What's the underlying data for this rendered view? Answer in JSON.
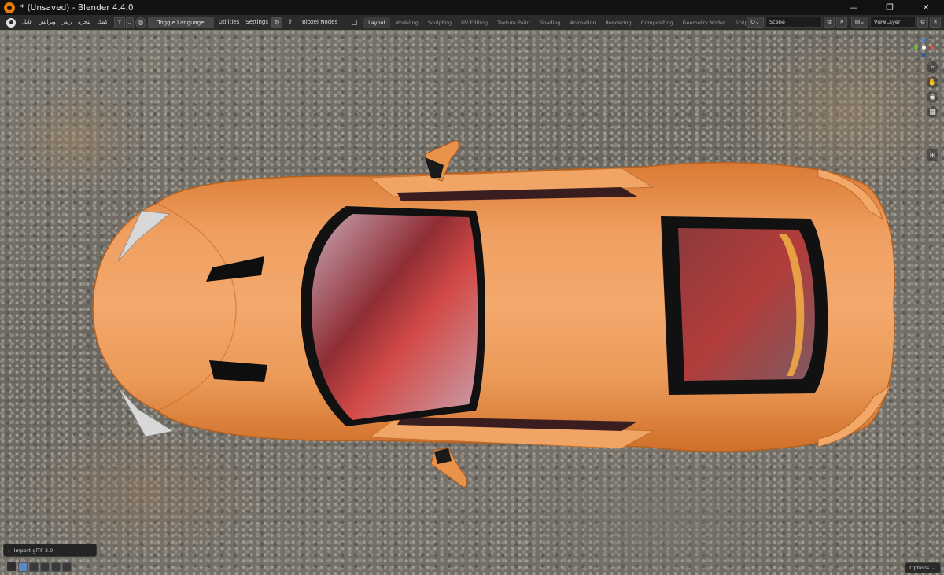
{
  "window": {
    "title": "* (Unsaved) - Blender 4.4.0",
    "minimize_glyph": "—",
    "maximize_glyph": "❐",
    "close_glyph": "✕"
  },
  "menu": {
    "items": [
      "فایل",
      "ویرایش",
      "رندر",
      "پنجره",
      "کمک"
    ],
    "toggle_language": "Toggle Language",
    "utilities": "Utilities",
    "settings": "Settings",
    "bioxel_nodes": "Bioxel Nodes"
  },
  "workspaces": [
    "Layout",
    "Modeling",
    "Sculpting",
    "UV Editing",
    "Texture Paint",
    "Shading",
    "Animation",
    "Rendering",
    "Compositing",
    "Geometry Nodes",
    "Scripting"
  ],
  "active_workspace": "Layout",
  "add_workspace_glyph": "+",
  "scene": {
    "label": "Scene"
  },
  "view_layer": {
    "label": "ViewLayer"
  },
  "viewport": {
    "operator_panel": "Import glTF 2.0",
    "options_label": "Options"
  },
  "icons": {
    "blender_logo": "blender-logo-icon",
    "gizmo": "navigation-gizmo-icon",
    "zoom": "zoom-icon",
    "pan": "hand-icon",
    "camera": "camera-icon",
    "perspective": "grid-icon"
  },
  "colors": {
    "accent": "#e87d0d",
    "car_paint": "#e8904a",
    "active_tool": "#4772b3"
  }
}
